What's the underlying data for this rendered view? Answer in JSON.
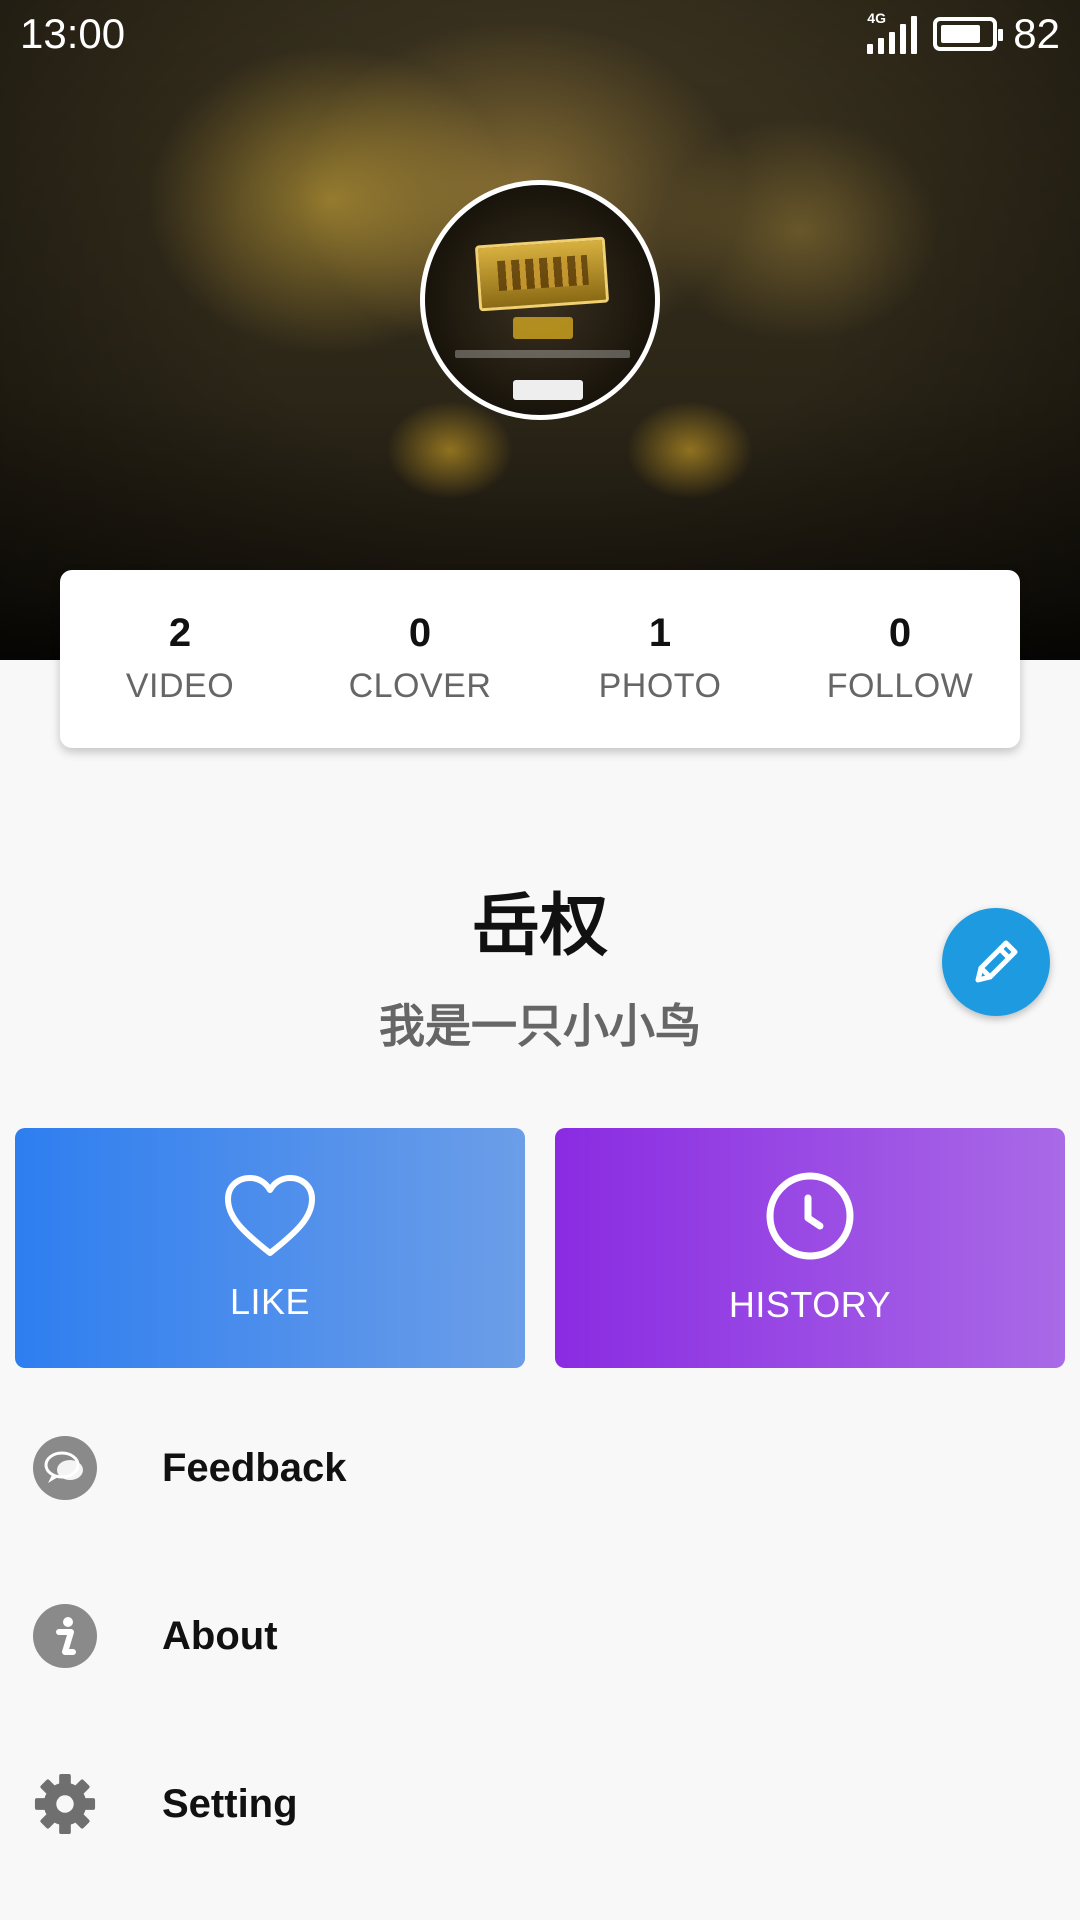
{
  "status_bar": {
    "time": "13:00",
    "network": "4G",
    "battery": "82"
  },
  "profile": {
    "name": "岳权",
    "bio": "我是一只小小鸟"
  },
  "stats": [
    {
      "value": "2",
      "label": "VIDEO"
    },
    {
      "value": "0",
      "label": "CLOVER"
    },
    {
      "value": "1",
      "label": "PHOTO"
    },
    {
      "value": "0",
      "label": "FOLLOW"
    }
  ],
  "actions": {
    "like_label": "LIKE",
    "history_label": "HISTORY"
  },
  "menu": [
    {
      "label": "Feedback",
      "icon": "chat-bubbles-icon"
    },
    {
      "label": "About",
      "icon": "info-icon"
    },
    {
      "label": "Setting",
      "icon": "gear-icon"
    }
  ],
  "colors": {
    "like_gradient_start": "#2e7ef0",
    "history_gradient_start": "#8a2be2",
    "edit_fab": "#1e9be0"
  }
}
